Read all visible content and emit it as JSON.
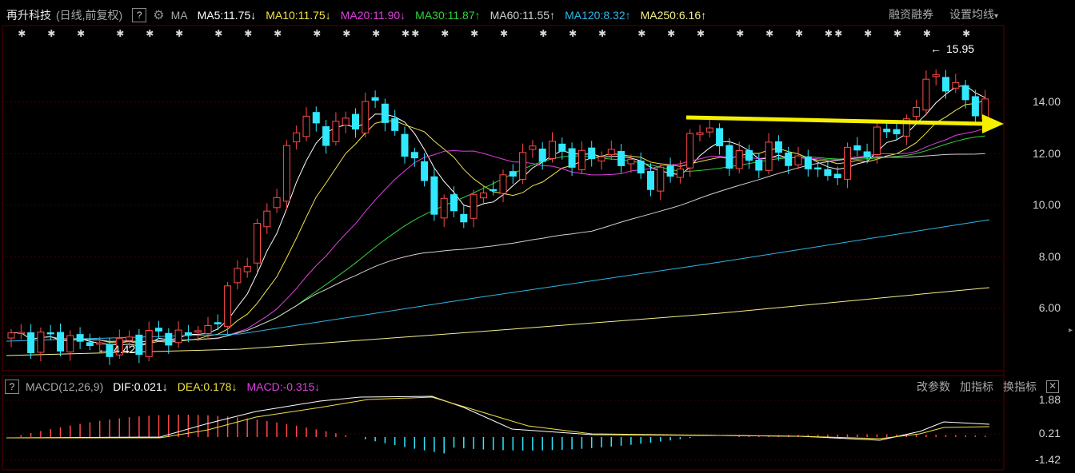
{
  "stock": {
    "name": "再升科技",
    "period": "(日线,前复权)",
    "ma_label": "MA"
  },
  "ma_indicators": [
    {
      "label": "MA5:11.75",
      "arrow": "↓",
      "color": "#ffffff"
    },
    {
      "label": "MA10:11.75",
      "arrow": "↓",
      "color": "#f0e24a"
    },
    {
      "label": "MA20:11.90",
      "arrow": "↓",
      "color": "#e040e0"
    },
    {
      "label": "MA30:11.87",
      "arrow": "↑",
      "color": "#32d23a"
    },
    {
      "label": "MA60:11.55",
      "arrow": "↑",
      "color": "#d0d0d0"
    },
    {
      "label": "MA120:8.32",
      "arrow": "↑",
      "color": "#2fb7e8"
    },
    {
      "label": "MA250:6.16",
      "arrow": "↑",
      "color": "#f5f08a"
    }
  ],
  "toolbar": {
    "margin_label": "融资融券",
    "ma_settings_label": "设置均线",
    "ma_settings_arrow": "▾"
  },
  "price_axis": [
    "14.00",
    "12.00",
    "10.00",
    "8.00",
    "6.00"
  ],
  "annotations": {
    "high_label": "15.95",
    "low_label": "4.42"
  },
  "macd_header": {
    "title": "MACD(12,26,9)",
    "dif": "DIF:0.021",
    "dif_arrow": "↓",
    "dea": "DEA:0.178",
    "dea_arrow": "↓",
    "macd": "MACD:-0.315",
    "macd_arrow": "↓",
    "btn_params": "改参数",
    "btn_add": "加指标",
    "btn_switch": "换指标",
    "close": "✕"
  },
  "macd_axis": [
    "1.88",
    "0.21",
    "-1.42"
  ],
  "colors": {
    "up": "#ff4a4a",
    "down": "#30e8ff",
    "arrow": "#f5f000",
    "grid": "#3a0000"
  }
}
